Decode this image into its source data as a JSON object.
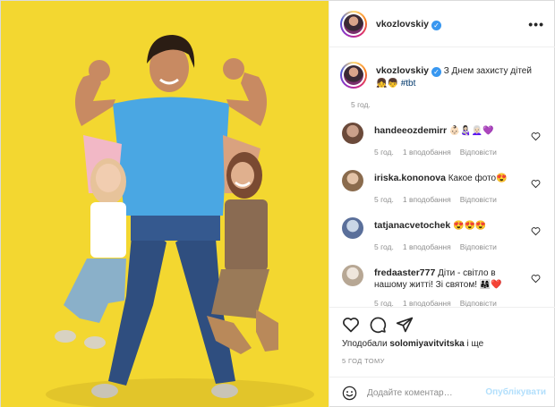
{
  "post": {
    "author": "vkozlovskiy",
    "more_icon": "more-horizontal-icon",
    "caption_text": "З Днем захисту дітей",
    "caption_emoji": "👧👦",
    "caption_hashtag": "#tbt",
    "caption_time": "5 год."
  },
  "comments": [
    {
      "user": "handeeozdemirr",
      "text": "👶🏻👩🏻‍🍼👩🏻‍🦳💜",
      "time": "5 год.",
      "likes": "1 вподобання",
      "reply": "Відповісти"
    },
    {
      "user": "iriska.kononova",
      "text": "Какое фото😍",
      "time": "5 год.",
      "likes": "1 вподобання",
      "reply": "Відповісти"
    },
    {
      "user": "tatjanacvetochek",
      "text": "😍😍😍",
      "time": "5 год.",
      "likes": "1 вподобання",
      "reply": "Відповісти"
    },
    {
      "user": "fredaaster777",
      "text": "Діти - світло в нашому житті! Зі святом! 👨‍👩‍👧❤️",
      "time": "5 год.",
      "likes": "1 вподобання",
      "reply": "Відповісти"
    }
  ],
  "footer": {
    "liked_by_prefix": "Уподобали ",
    "liked_by_user": "solomiyavitvitska",
    "liked_by_suffix": " і ще",
    "time": "5 ГОД ТОМУ",
    "comment_placeholder": "Додайте коментар…",
    "publish_label": "Опублікувати"
  },
  "colors": {
    "photo_background": "#f3d730",
    "verified_badge": "#3897f0",
    "link": "#00376b",
    "publish_disabled": "#b2dffc",
    "meta_gray": "#8e8e8e"
  }
}
